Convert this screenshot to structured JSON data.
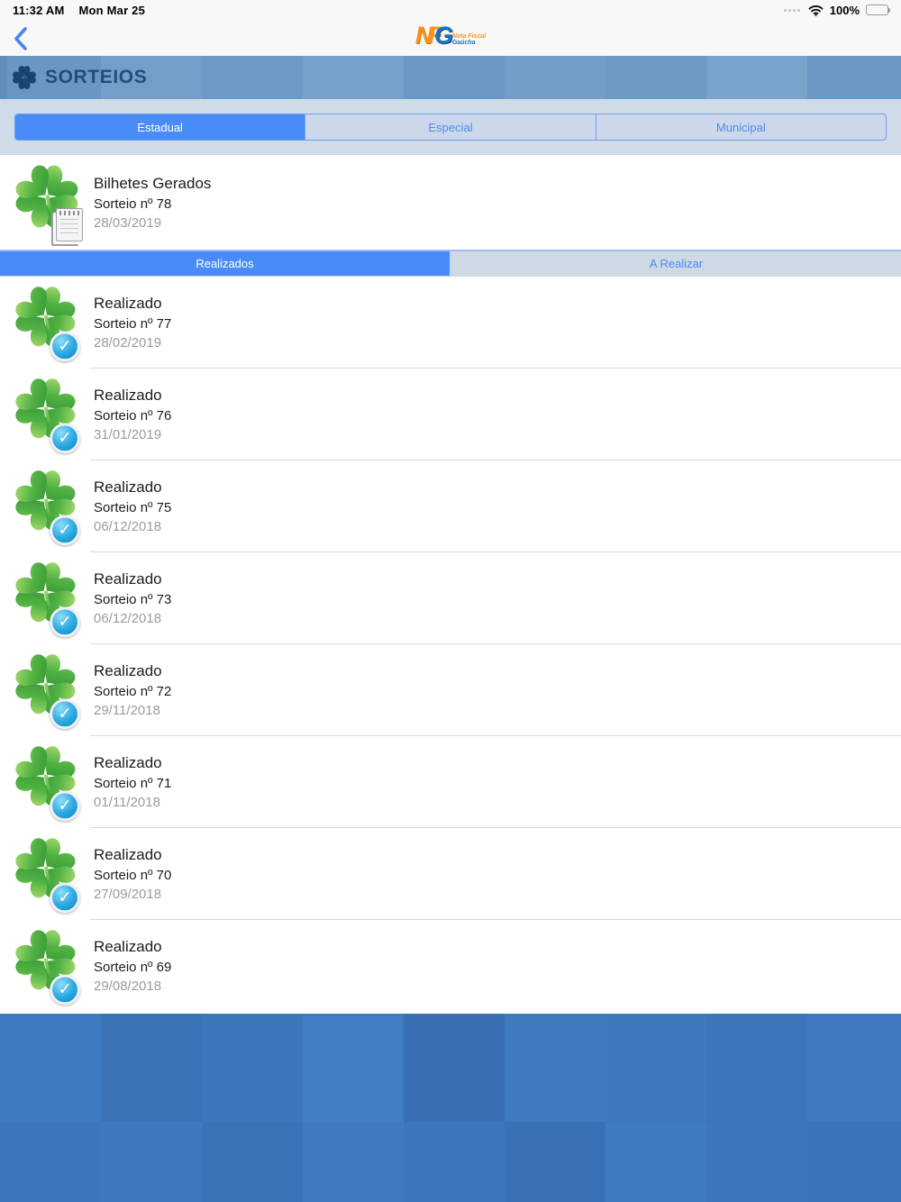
{
  "status_bar": {
    "time": "11:32 AM",
    "date": "Mon Mar 25",
    "battery_percent": "100%"
  },
  "nav_bar": {
    "logo": {
      "letter_n": "N",
      "letter_f": "F",
      "letter_g": "G",
      "tagline_1": "Nota Fiscal",
      "tagline_2": "Gaúcha"
    }
  },
  "header": {
    "title": "SORTEIOS"
  },
  "region_tabs": {
    "items": [
      {
        "label": "Estadual",
        "selected": true
      },
      {
        "label": "Especial",
        "selected": false
      },
      {
        "label": "Municipal",
        "selected": false
      }
    ]
  },
  "featured": {
    "title": "Bilhetes Gerados",
    "subtitle": "Sorteio nº 78",
    "date": "28/03/2019"
  },
  "status_tabs": {
    "items": [
      {
        "label": "Realizados",
        "selected": true
      },
      {
        "label": "A Realizar",
        "selected": false
      }
    ]
  },
  "draws": [
    {
      "title": "Realizado",
      "subtitle": "Sorteio nº 77",
      "date": "28/02/2019"
    },
    {
      "title": "Realizado",
      "subtitle": "Sorteio nº 76",
      "date": "31/01/2019"
    },
    {
      "title": "Realizado",
      "subtitle": "Sorteio nº 75",
      "date": "06/12/2018"
    },
    {
      "title": "Realizado",
      "subtitle": "Sorteio nº 73",
      "date": "06/12/2018"
    },
    {
      "title": "Realizado",
      "subtitle": "Sorteio nº 72",
      "date": "29/11/2018"
    },
    {
      "title": "Realizado",
      "subtitle": "Sorteio nº 71",
      "date": "01/11/2018"
    },
    {
      "title": "Realizado",
      "subtitle": "Sorteio nº 70",
      "date": "27/09/2018"
    },
    {
      "title": "Realizado",
      "subtitle": "Sorteio nº 69",
      "date": "29/08/2018"
    }
  ],
  "icons": {
    "back": "chevron-left-icon",
    "header": "clover-icon",
    "draw": "clover-icon",
    "done": "check-badge-icon",
    "tickets": "notepad-icon",
    "wifi": "wifi-icon",
    "battery": "battery-icon",
    "cellular": "cellular-dots-icon"
  },
  "colors": {
    "accent_blue": "#4a8cf7",
    "header_bg": "#6f9cc5",
    "header_text": "#1d4e7c",
    "band_bg": "#cfdbe9",
    "clover_green_light": "#a8dc6e",
    "clover_green_dark": "#2a9030",
    "badge_blue": "#29a8e0",
    "footer_blue": "#3c77bb",
    "date_gray": "#9b9b9b"
  }
}
